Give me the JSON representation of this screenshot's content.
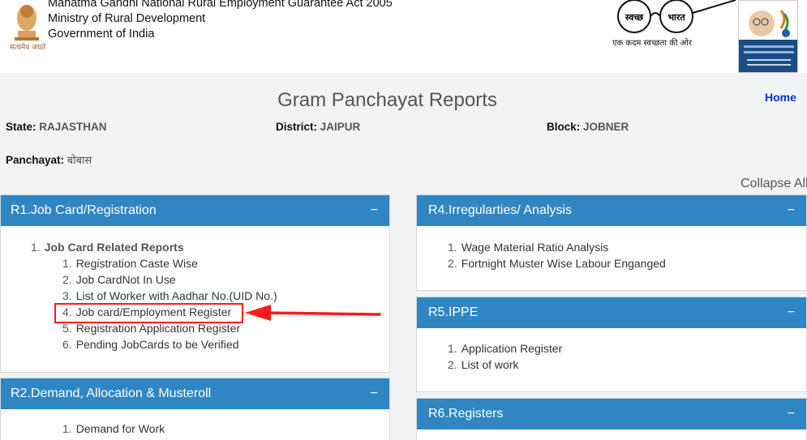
{
  "header": {
    "line1": "Mahatma Gandhi National Rural Employment Guarantee Act 2005",
    "line2": "Ministry of Rural Development",
    "line3": "Government of India",
    "emblem_motto": "सत्यमेव जयते",
    "swachh_word1": "स्वच्छ",
    "swachh_word2": "भारत",
    "swachh_tagline": "एक कदम स्वच्छता की ओर"
  },
  "page": {
    "title": "Gram Panchayat Reports",
    "home_label": "Home",
    "collapse_all_label": "Collapse All"
  },
  "location": {
    "state_label": "State:",
    "state_value": "RAJASTHAN",
    "district_label": "District:",
    "district_value": "JAIPUR",
    "block_label": "Block:",
    "block_value": "JOBNER",
    "panchayat_label": "Panchayat:",
    "panchayat_value": "बोबास"
  },
  "panels": {
    "r1": {
      "title": "R1.Job Card/Registration",
      "toggle": "−",
      "group_num": "1.",
      "group_title": "Job Card Related Reports",
      "items": [
        {
          "num": "1.",
          "label": "Registration Caste Wise"
        },
        {
          "num": "2.",
          "label": "Job CardNot In Use"
        },
        {
          "num": "3.",
          "label": "List of Worker with Aadhar No.(UID No.)"
        },
        {
          "num": "4.",
          "label": "Job card/Employment Register"
        },
        {
          "num": "5.",
          "label": "Registration Application Register"
        },
        {
          "num": "6.",
          "label": "Pending JobCards to be Verified"
        }
      ]
    },
    "r2": {
      "title": "R2.Demand, Allocation & Musteroll",
      "toggle": "−",
      "items": [
        {
          "num": "1.",
          "label": "Demand for Work"
        }
      ]
    },
    "r4": {
      "title": "R4.Irregularties/ Analysis",
      "toggle": "−",
      "items": [
        {
          "num": "1.",
          "label": "Wage Material Ratio Analysis"
        },
        {
          "num": "2.",
          "label": "Fortnight Muster Wise Labour Enganged"
        }
      ]
    },
    "r5": {
      "title": "R5.IPPE",
      "toggle": "−",
      "items": [
        {
          "num": "1.",
          "label": "Application Register"
        },
        {
          "num": "2.",
          "label": "List of work"
        }
      ]
    },
    "r6": {
      "title": "R6.Registers",
      "toggle": "−"
    }
  },
  "annotation_color": "#ff1a1a",
  "accent_color": "#2f86c2"
}
